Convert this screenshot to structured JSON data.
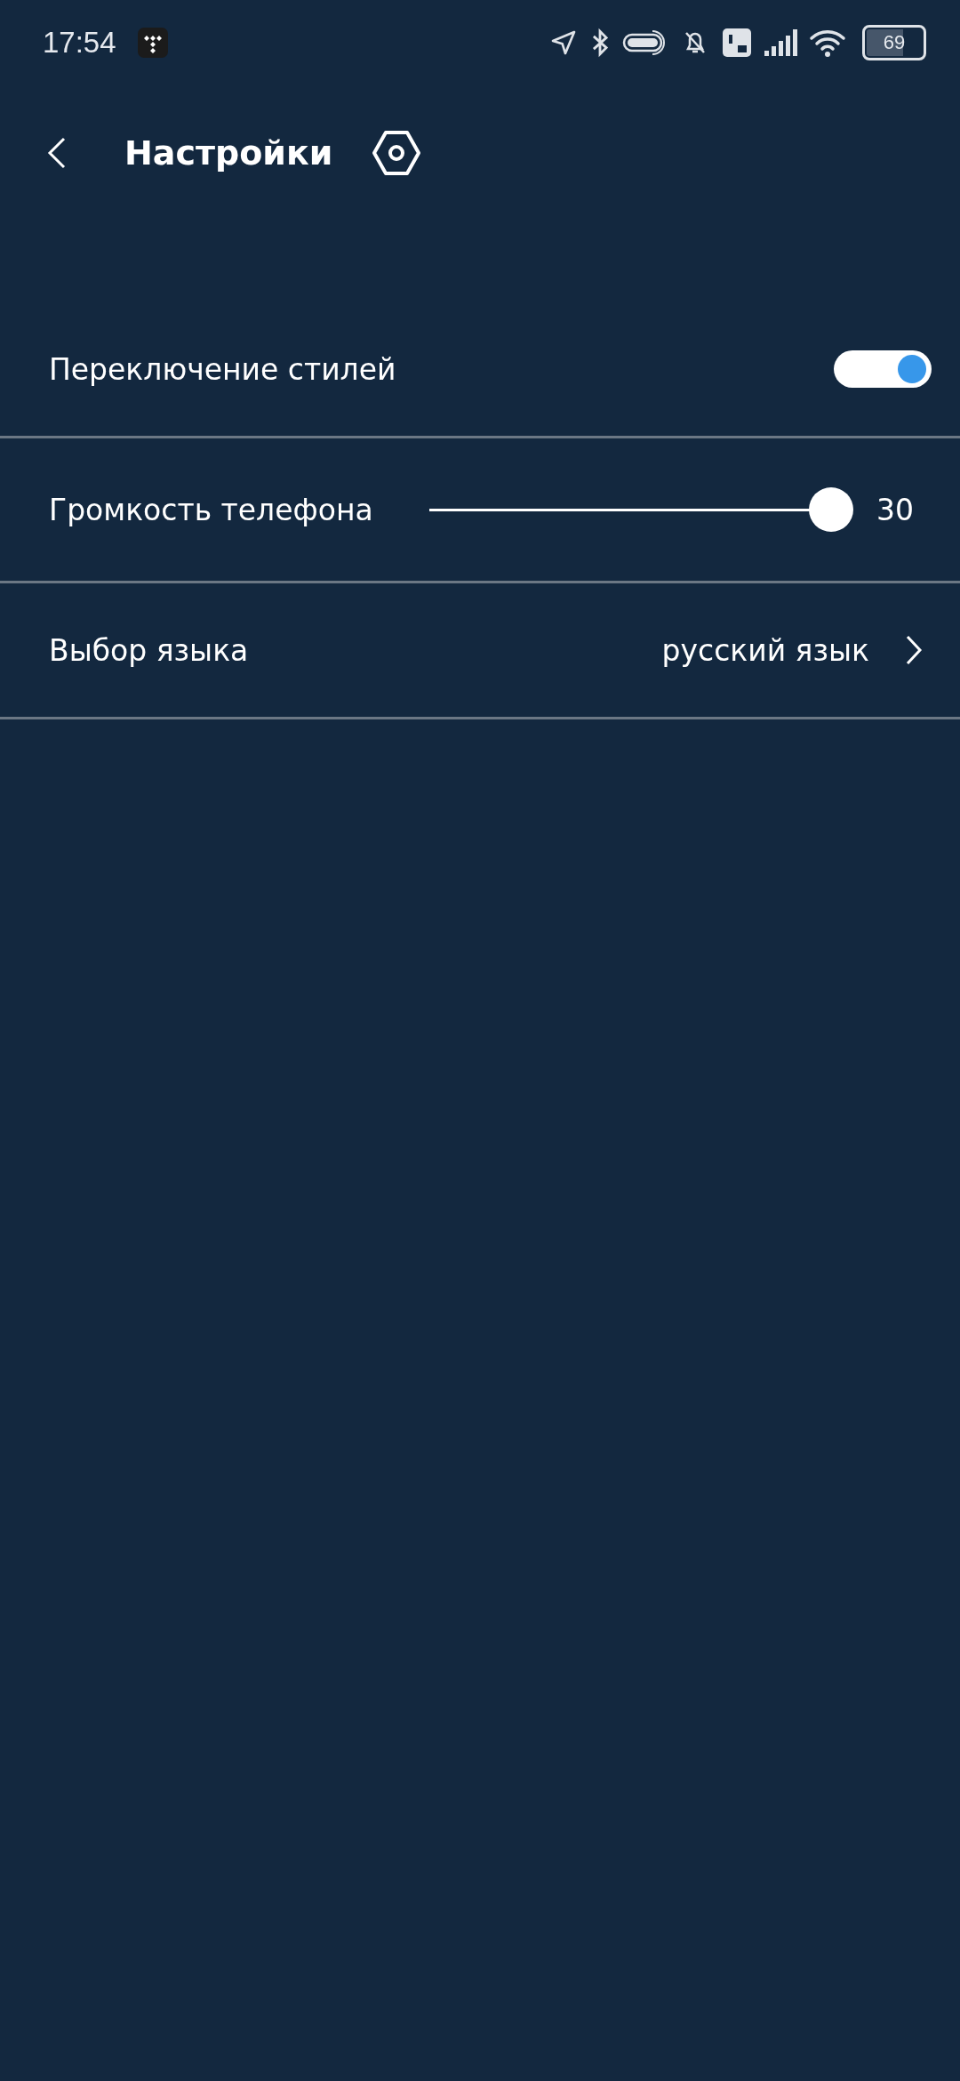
{
  "status_bar": {
    "time": "17:54",
    "battery": "69"
  },
  "header": {
    "title": "Настройки"
  },
  "settings": [
    {
      "kind": "toggle",
      "label": "Переключение стилей",
      "on": true
    },
    {
      "kind": "slider",
      "label": "Громкость телефона",
      "level": 1,
      "reading": "30"
    },
    {
      "kind": "select",
      "label": "Выбор языка",
      "value": "русский язык"
    }
  ]
}
